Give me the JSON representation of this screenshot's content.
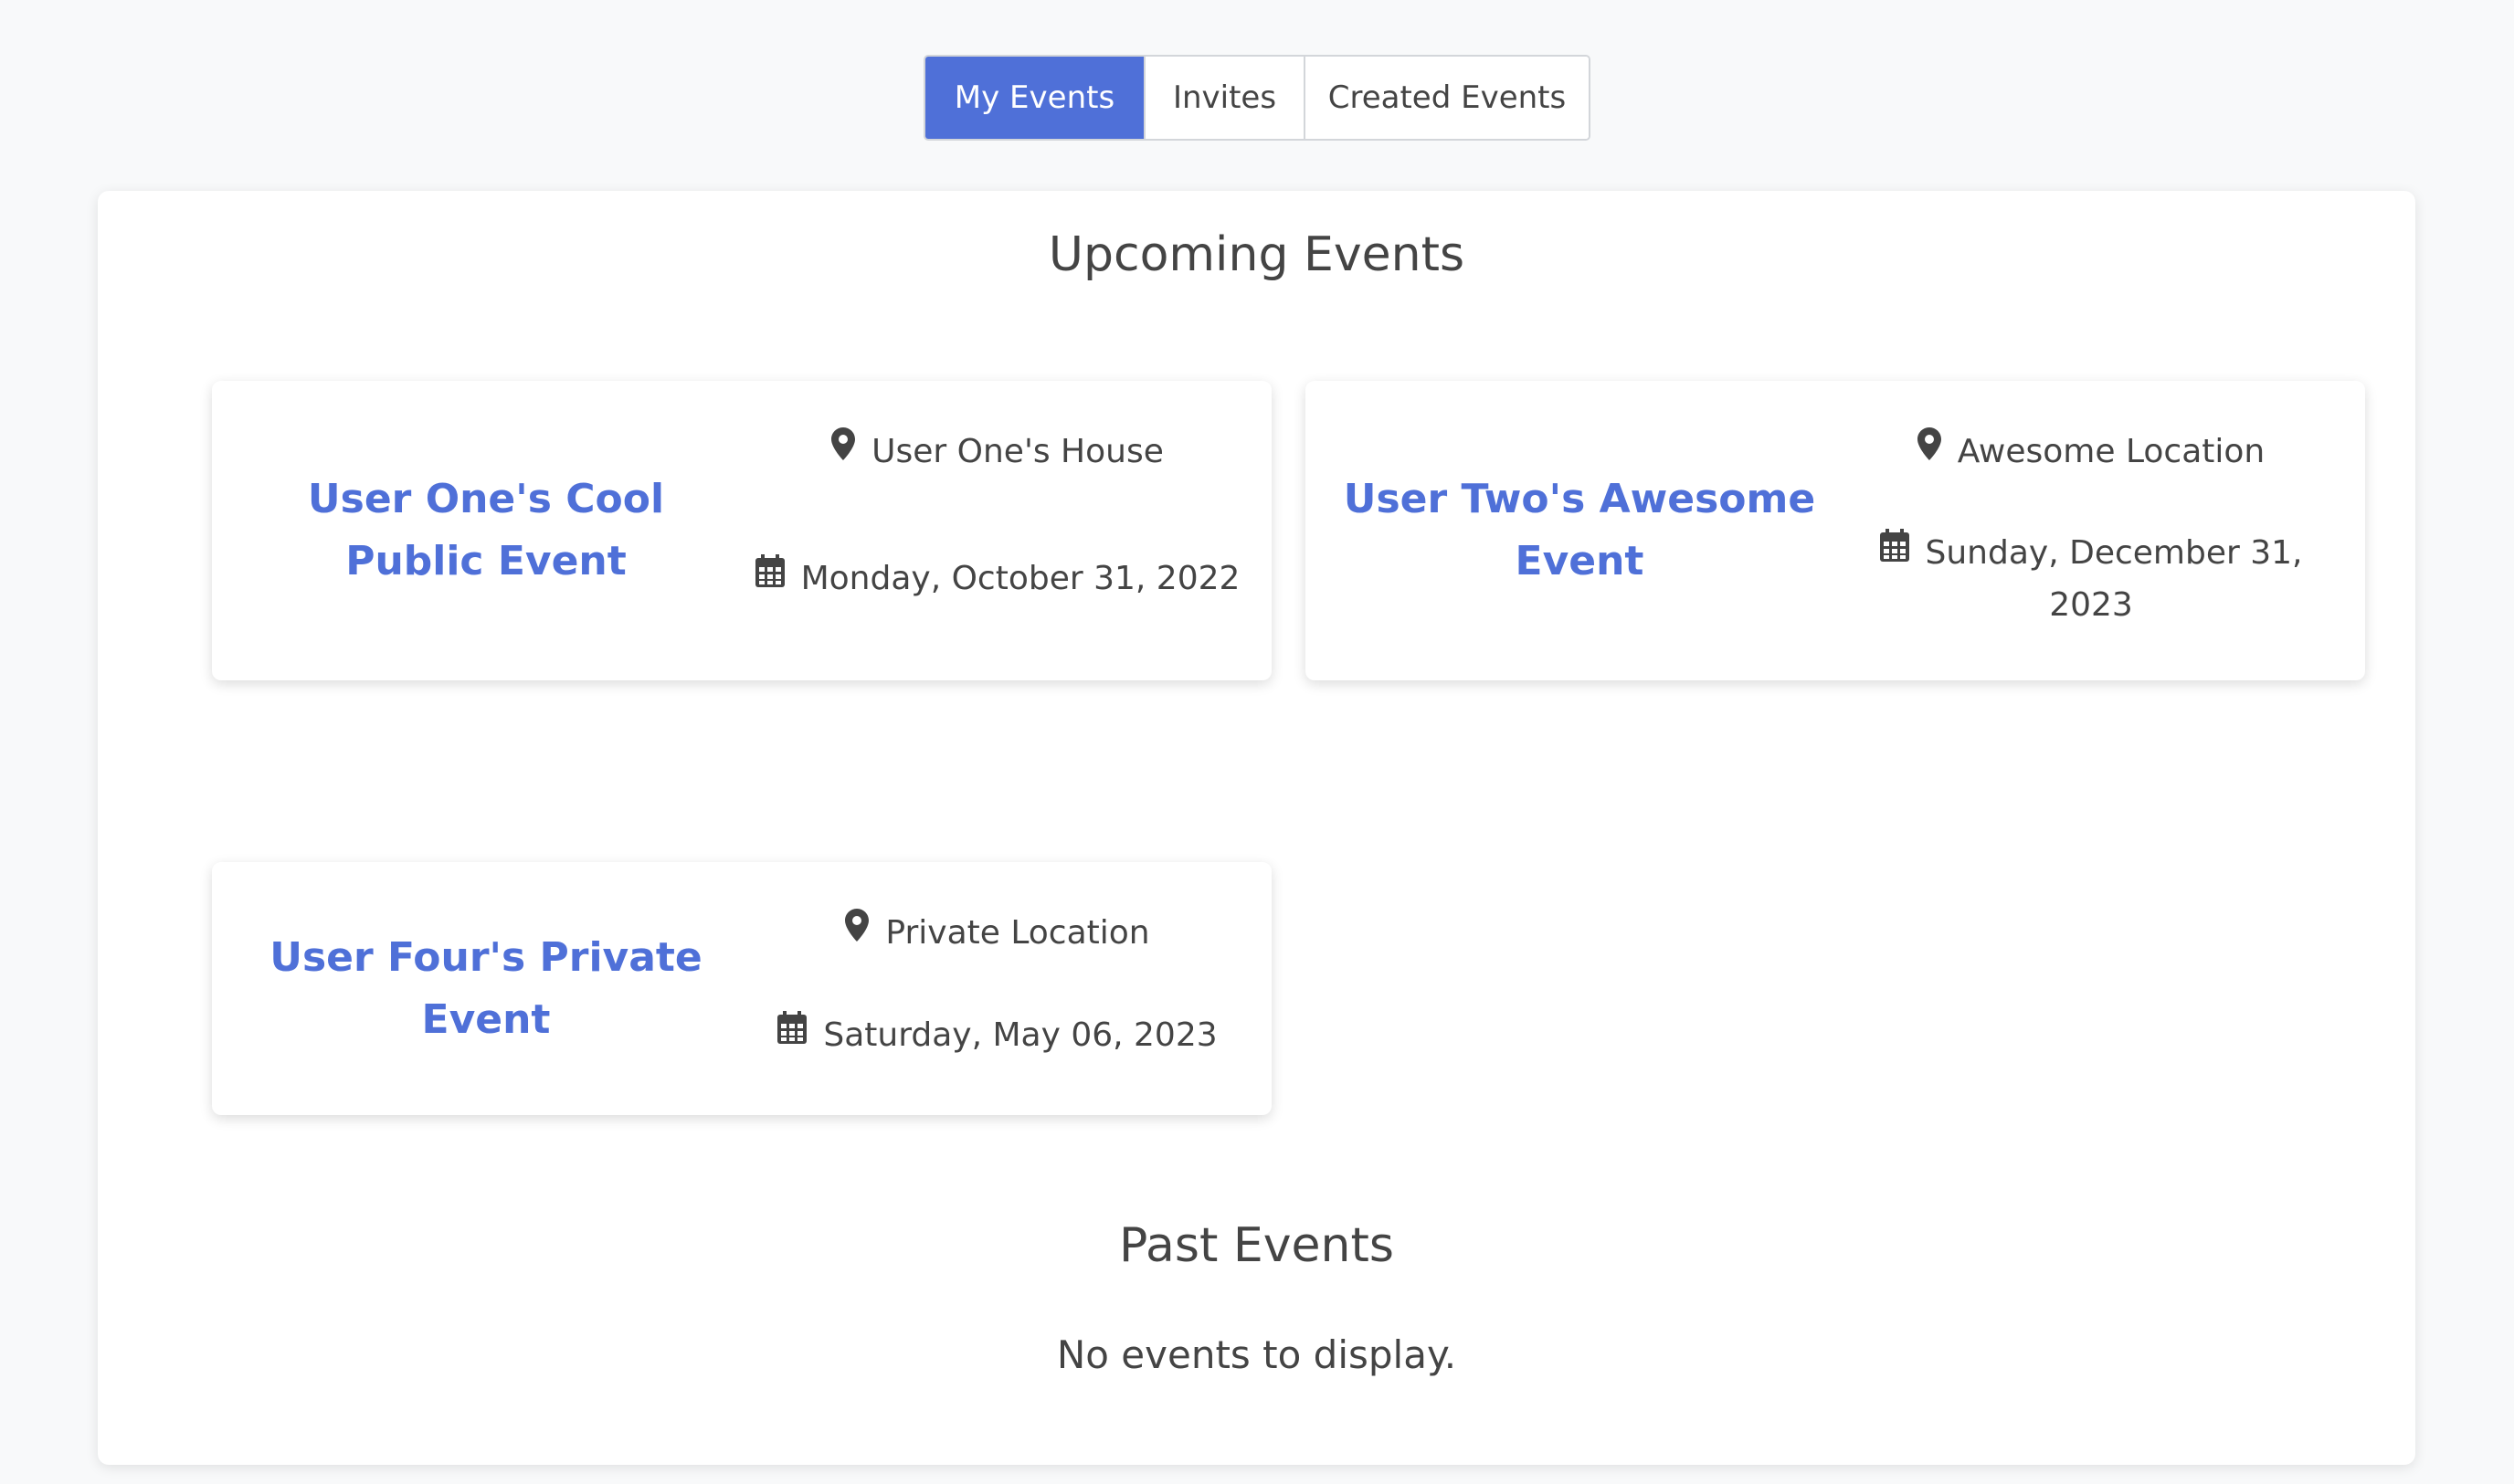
{
  "tabs": [
    {
      "label": "My Events",
      "active": true
    },
    {
      "label": "Invites",
      "active": false
    },
    {
      "label": "Created Events",
      "active": false
    }
  ],
  "upcoming": {
    "title": "Upcoming Events",
    "events": [
      {
        "name": "User One's Cool Public Event",
        "location": "User One's House",
        "date": "Monday, October 31, 2022"
      },
      {
        "name": "User Two's Awesome Event",
        "location": "Awesome Location",
        "date_line1": "Sunday, December 31,",
        "date_line2": "2023"
      },
      {
        "name": "User Four's Private Event",
        "location": "Private Location",
        "date": "Saturday, May 06, 2023"
      }
    ]
  },
  "past": {
    "title": "Past Events",
    "empty_text": "No events to display."
  },
  "icons": {
    "location": "map-marker-icon",
    "date": "calendar-icon"
  },
  "colors": {
    "accent": "#4f70d8",
    "text": "#444444",
    "background": "#f8f9fa",
    "card": "#ffffff"
  }
}
